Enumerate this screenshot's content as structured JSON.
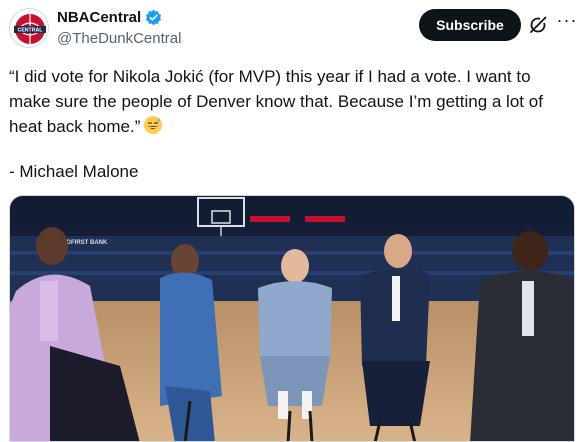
{
  "account": {
    "display_name": "NBACentral",
    "handle": "@TheDunkCentral",
    "avatar_text": "CENTRAL",
    "verified_color": "#1d9bf0"
  },
  "actions": {
    "subscribe_label": "Subscribe",
    "more_label": "···"
  },
  "tweet": {
    "text": "“I did vote for Nikola Jokić (for MVP) this year if I had a vote. I want to make sure the people of Denver know that. Because I’m getting a lot of heat back home.”",
    "attribution": "- Michael Malone"
  },
  "media": {
    "arena_sign": "MIDFIRST BANK",
    "description_icon": "video-still"
  },
  "colors": {
    "text_primary": "#0f1419",
    "text_secondary": "#536471",
    "button_bg": "#0f1419"
  }
}
